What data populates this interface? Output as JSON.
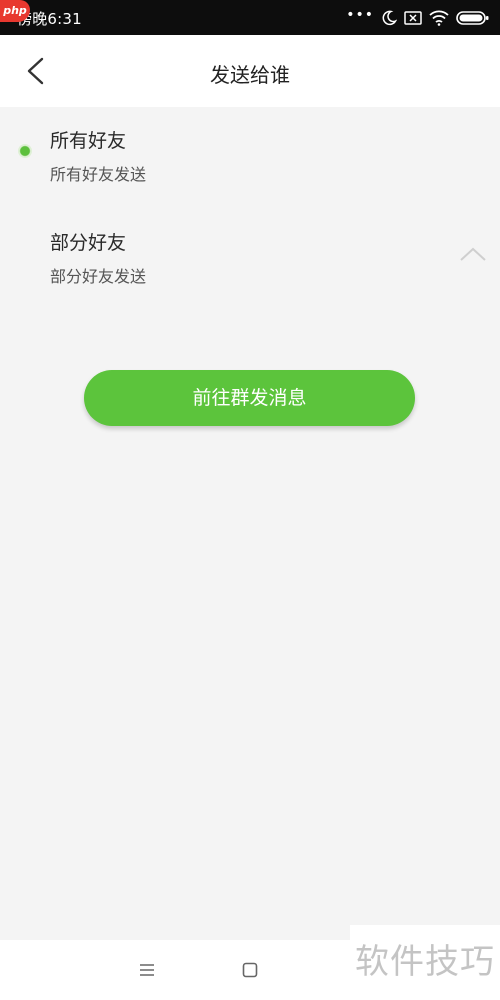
{
  "status_bar": {
    "time": "傍晚6:31",
    "badge": "php",
    "icons": [
      "more-dots-icon",
      "moon-icon",
      "sim-icon",
      "wifi-icon",
      "battery-icon"
    ]
  },
  "header": {
    "title": "发送给谁",
    "back_icon": "chevron-left-icon"
  },
  "options": [
    {
      "title": "所有好友",
      "subtitle": "所有好友发送",
      "selected": true
    },
    {
      "title": "部分好友",
      "subtitle": "部分好友发送",
      "selected": false,
      "expand_icon": "chevron-up-icon"
    }
  ],
  "action": {
    "label": "前往群发消息"
  },
  "nav_bar": {
    "icons": [
      "menu-icon",
      "home-icon"
    ]
  },
  "watermark": {
    "text": "软件技巧"
  },
  "colors": {
    "accent_green": "#5cc43c",
    "page_background": "#f4f4f4",
    "status_bar": "#0d0d0d"
  }
}
